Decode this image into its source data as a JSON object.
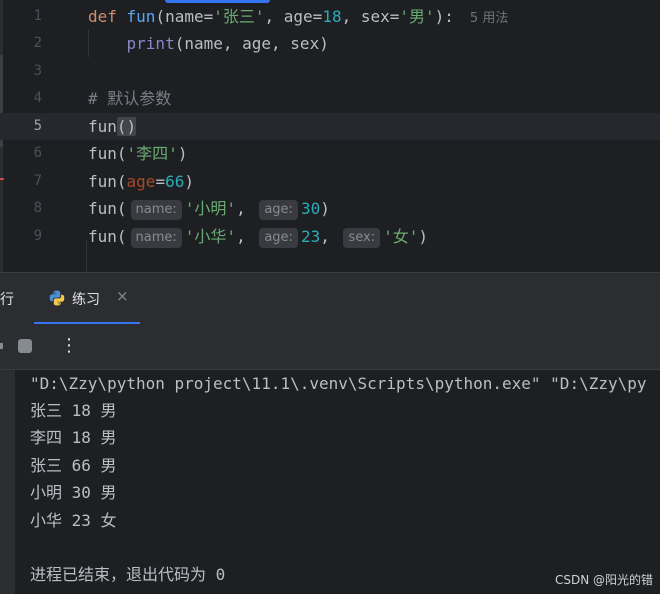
{
  "editor": {
    "lines": [
      {
        "num": "1",
        "tokens": [
          [
            "kw",
            "def "
          ],
          [
            "fn",
            "fun"
          ],
          [
            "p",
            "(name="
          ],
          [
            "str",
            "'张三'"
          ],
          [
            "p",
            ", age="
          ],
          [
            "num",
            "18"
          ],
          [
            "p",
            ", sex="
          ],
          [
            "str",
            "'男'"
          ],
          [
            "p",
            "):"
          ]
        ],
        "usage": "5 用法"
      },
      {
        "num": "2",
        "tokens": [
          [
            "p",
            "    "
          ],
          [
            "builtin",
            "print"
          ],
          [
            "p",
            "(name, age, sex)"
          ]
        ]
      },
      {
        "num": "3",
        "tokens": []
      },
      {
        "num": "4",
        "tokens": [
          [
            "cmt",
            "# 默认参数"
          ]
        ]
      },
      {
        "num": "5",
        "tokens": [
          [
            "p",
            "fun"
          ],
          [
            "hl",
            "()"
          ]
        ],
        "current": true
      },
      {
        "num": "6",
        "tokens": [
          [
            "p",
            "fun("
          ],
          [
            "str",
            "'李四'"
          ],
          [
            "p",
            ")"
          ]
        ]
      },
      {
        "num": "7",
        "tokens": [
          [
            "p",
            "fun("
          ],
          [
            "named",
            "age"
          ],
          [
            "p",
            "="
          ],
          [
            "num",
            "66"
          ],
          [
            "p",
            ")"
          ]
        ]
      },
      {
        "num": "8",
        "tokens": [
          [
            "p",
            "fun("
          ],
          [
            "hint",
            "name:"
          ],
          [
            "str",
            "'小明'"
          ],
          [
            "p",
            ", "
          ],
          [
            "hint",
            "age:"
          ],
          [
            "num",
            "30"
          ],
          [
            "p",
            ")"
          ]
        ]
      },
      {
        "num": "9",
        "tokens": [
          [
            "p",
            "fun("
          ],
          [
            "hint",
            "name:"
          ],
          [
            "str",
            "'小华'"
          ],
          [
            "p",
            ", "
          ],
          [
            "hint",
            "age:"
          ],
          [
            "num",
            "23"
          ],
          [
            "p",
            ", "
          ],
          [
            "hint",
            "sex:"
          ],
          [
            "str",
            "'女'"
          ],
          [
            "p",
            ")"
          ]
        ]
      }
    ]
  },
  "run_panel": {
    "run_tab_label": "行",
    "tab_label": "练习",
    "close_glyph": "×",
    "more_glyph": "⋮"
  },
  "console": {
    "command": "\"D:\\Zzy\\python project\\11.1\\.venv\\Scripts\\python.exe\" \"D:\\Zzy\\py",
    "output": [
      "张三 18 男",
      "李四 18 男",
      "张三 66 男",
      "小明 30 男",
      "小华 23 女"
    ],
    "exit_message": "进程已结束，退出代码为 0"
  },
  "watermark": "CSDN @阳光的错",
  "colors": {
    "keyword": "#cf8e6d",
    "function": "#56a8f5",
    "string": "#6aab73",
    "number": "#2aacb8",
    "accent": "#3574f0"
  }
}
